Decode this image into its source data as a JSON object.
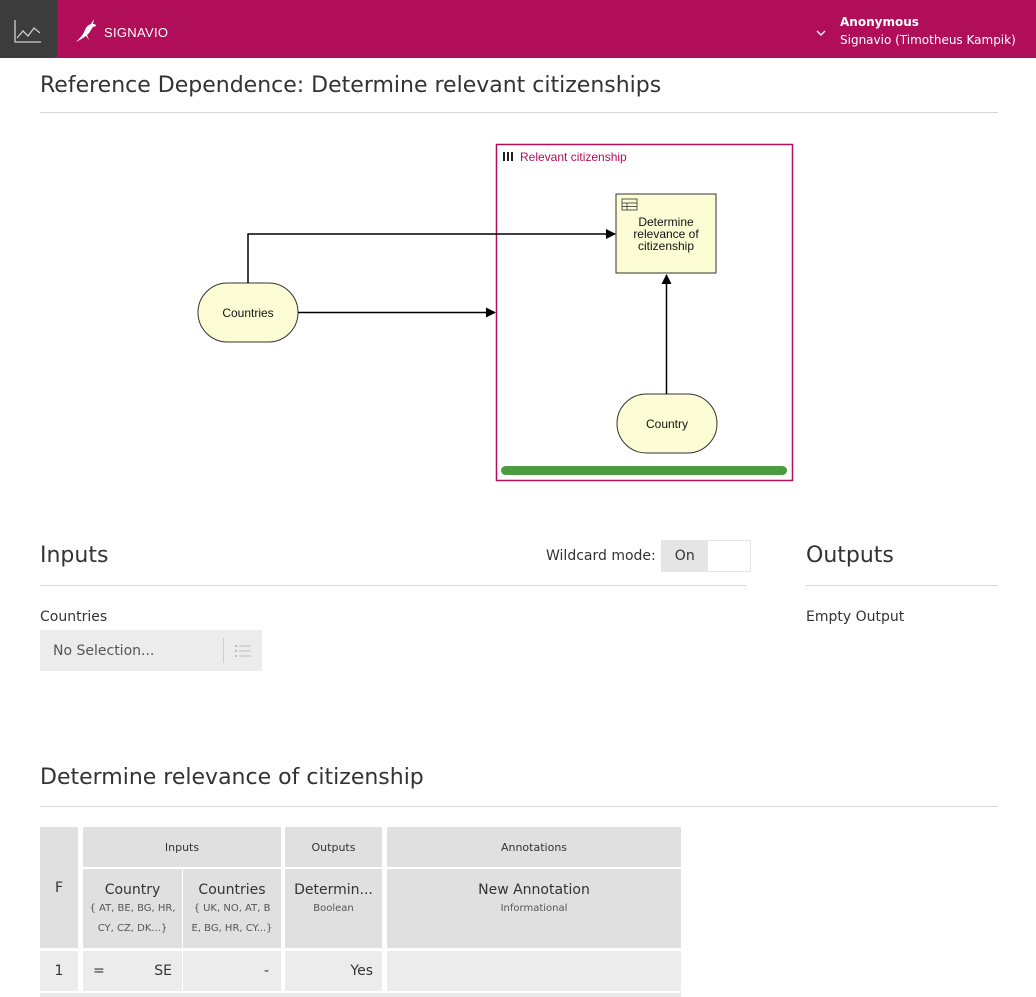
{
  "header": {
    "brand": "SIGNAVIO",
    "user_name": "Anonymous",
    "user_org": "Signavio (Timotheus Kampik)",
    "accent_color": "#b10e5a",
    "icons": [
      "chart-icon",
      "signavio-logo",
      "chevron-down-icon"
    ]
  },
  "page": {
    "title": "Reference Dependence: Determine relevant citizenships"
  },
  "diagram": {
    "service_label": "Relevant citizenship",
    "decision_label_lines": [
      "Determine",
      "relevance of",
      "citizenship"
    ],
    "input_countries": "Countries",
    "input_country": "Country",
    "colors": {
      "node_fill": "#fdfdd5",
      "service_border": "#b10e5a",
      "progress": "#4a9c3e"
    }
  },
  "inputs": {
    "title": "Inputs",
    "wildcard_label": "Wildcard mode:",
    "wildcard_value": "On",
    "field_label": "Countries",
    "select_placeholder": "No Selection...",
    "icons": [
      "list-icon"
    ]
  },
  "outputs": {
    "title": "Outputs",
    "empty_text": "Empty Output"
  },
  "decision_table": {
    "title": "Determine relevance of citizenship",
    "hit_policy": "F",
    "group_inputs": "Inputs",
    "group_outputs": "Outputs",
    "group_annotations": "Annotations",
    "columns": [
      {
        "name": "Country",
        "values_line1": "{ AT, BE, BG, HR,",
        "values_line2": "CY, CZ, DK...}"
      },
      {
        "name": "Countries",
        "values_line1": "{ UK, NO, AT, B",
        "values_line2": "E, BG, HR, CY...}"
      },
      {
        "name": "Determin...",
        "type": "Boolean"
      },
      {
        "name": "New Annotation",
        "type": "Informational"
      }
    ],
    "rows": [
      {
        "index": "1",
        "op": "=",
        "country": "SE",
        "countries": "-",
        "output": "Yes",
        "annotation": ""
      }
    ]
  }
}
